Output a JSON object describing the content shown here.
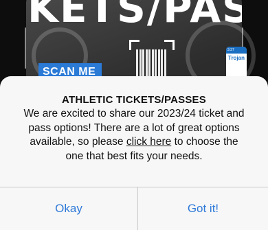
{
  "background": {
    "headline": "KETS/PAS",
    "scan_label": "SCAN ME",
    "mini_phone_time": "3:37",
    "mini_phone_brand": "Trojan"
  },
  "alert": {
    "title": "ATHLETIC TICKETS/PASSES",
    "body_before_link": "We are excited to share our 2023/24 ticket and pass options! There are a lot of great options available, so please ",
    "link_text": "click here",
    "body_after_link": " to choose the one that best fits your needs.",
    "buttons": {
      "okay": "Okay",
      "got_it": "Got it!"
    },
    "colors": {
      "button_text": "#2f7ad8",
      "sheet_background": "#f7f7f7"
    }
  }
}
